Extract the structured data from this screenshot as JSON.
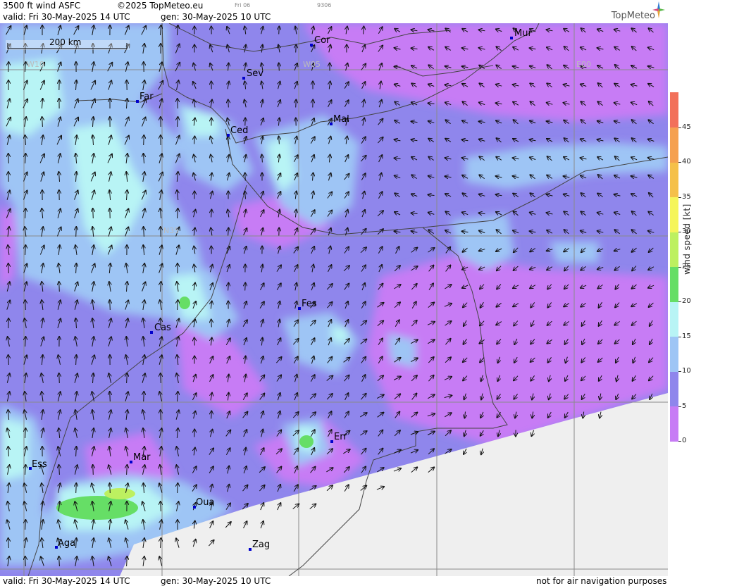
{
  "header": {
    "title": "3500 ft wind ASFC",
    "copyright": "©2025 TopMeteo.eu",
    "day_marker": "Fri 06",
    "code": "9306",
    "valid": "valid:  Fri  30-May-2025  14 UTC",
    "gen": "gen: 30-May-2025 10 UTC",
    "logo": "TopMeteo"
  },
  "footer": {
    "valid": "valid:  Fri  30-May-2025  14 UTC",
    "gen": "gen: 30-May-2025 10 UTC",
    "disclaimer": "not for air navigation purposes"
  },
  "scale": {
    "label": "200 km"
  },
  "grid_labels": {
    "w10": "W10",
    "w05": "W05",
    "e00": "E00",
    "n35": "N35"
  },
  "cities": [
    {
      "name": "Cor"
    },
    {
      "name": "Mur"
    },
    {
      "name": "Sev"
    },
    {
      "name": "Far"
    },
    {
      "name": "Mal"
    },
    {
      "name": "Ced"
    },
    {
      "name": "Fes"
    },
    {
      "name": "Cas"
    },
    {
      "name": "Err"
    },
    {
      "name": "Mar"
    },
    {
      "name": "Ess"
    },
    {
      "name": "Oua"
    },
    {
      "name": "Aga"
    },
    {
      "name": "Zag"
    }
  ],
  "legend": {
    "title": "wind speed [kt]",
    "ticks": [
      "0",
      "5",
      "10",
      "15",
      "20",
      "25",
      "30",
      "35",
      "40",
      "45"
    ],
    "colors": [
      "#c77cf5",
      "#8f86ec",
      "#9ec5f5",
      "#b8f4f5",
      "#66de66",
      "#bdf060",
      "#f5f55a",
      "#f5c04a",
      "#f5a050",
      "#f2705a"
    ]
  }
}
